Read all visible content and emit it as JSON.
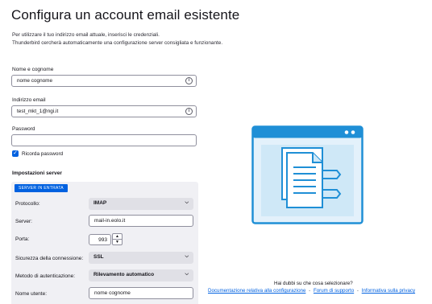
{
  "header": {
    "title": "Configura un account email esistente",
    "intro_line1": "Per utilizzare il tuo indirizzo email attuale, inserisci le credenziali.",
    "intro_line2": "Thunderbird cercherà automaticamente una configurazione server consigliata e funzionante."
  },
  "form": {
    "name_label": "Nome e cognome",
    "name_value": "nome cognome",
    "email_label": "Indirizzo email",
    "email_value": "test_mkt_1@ngi.it",
    "password_label": "Password",
    "password_value": "",
    "remember_label": "Ricorda password",
    "remember_checked": true
  },
  "server": {
    "section_title": "Impostazioni server",
    "badge": "SERVER IN ENTRATA",
    "protocol_label": "Protocollo:",
    "protocol_value": "IMAP",
    "server_label": "Server:",
    "server_value": "mail-in.eolo.it",
    "port_label": "Porta:",
    "port_value": "993",
    "security_label": "Sicurezza della connessione:",
    "security_value": "SSL",
    "auth_label": "Metodo di autenticazione:",
    "auth_value": "Rilevamento automatico",
    "username_label": "Nome utente:",
    "username_value": "nome cognome"
  },
  "help": {
    "question": "Hai dubbi su che cosa selezionare?",
    "link1": "Documentazione relativa alla configurazione",
    "link2": "Forum di supporto",
    "link3": "Informativa sulla privacy",
    "separator": "-"
  },
  "icons": {
    "info": "info-icon",
    "check": "checkmark-icon",
    "chevron": "chevron-down-icon",
    "illustration": "document-window-illustration"
  },
  "colors": {
    "accent": "#0061e0",
    "illustration_light": "#cfe8f7",
    "illustration_dark": "#1f8fd6"
  }
}
